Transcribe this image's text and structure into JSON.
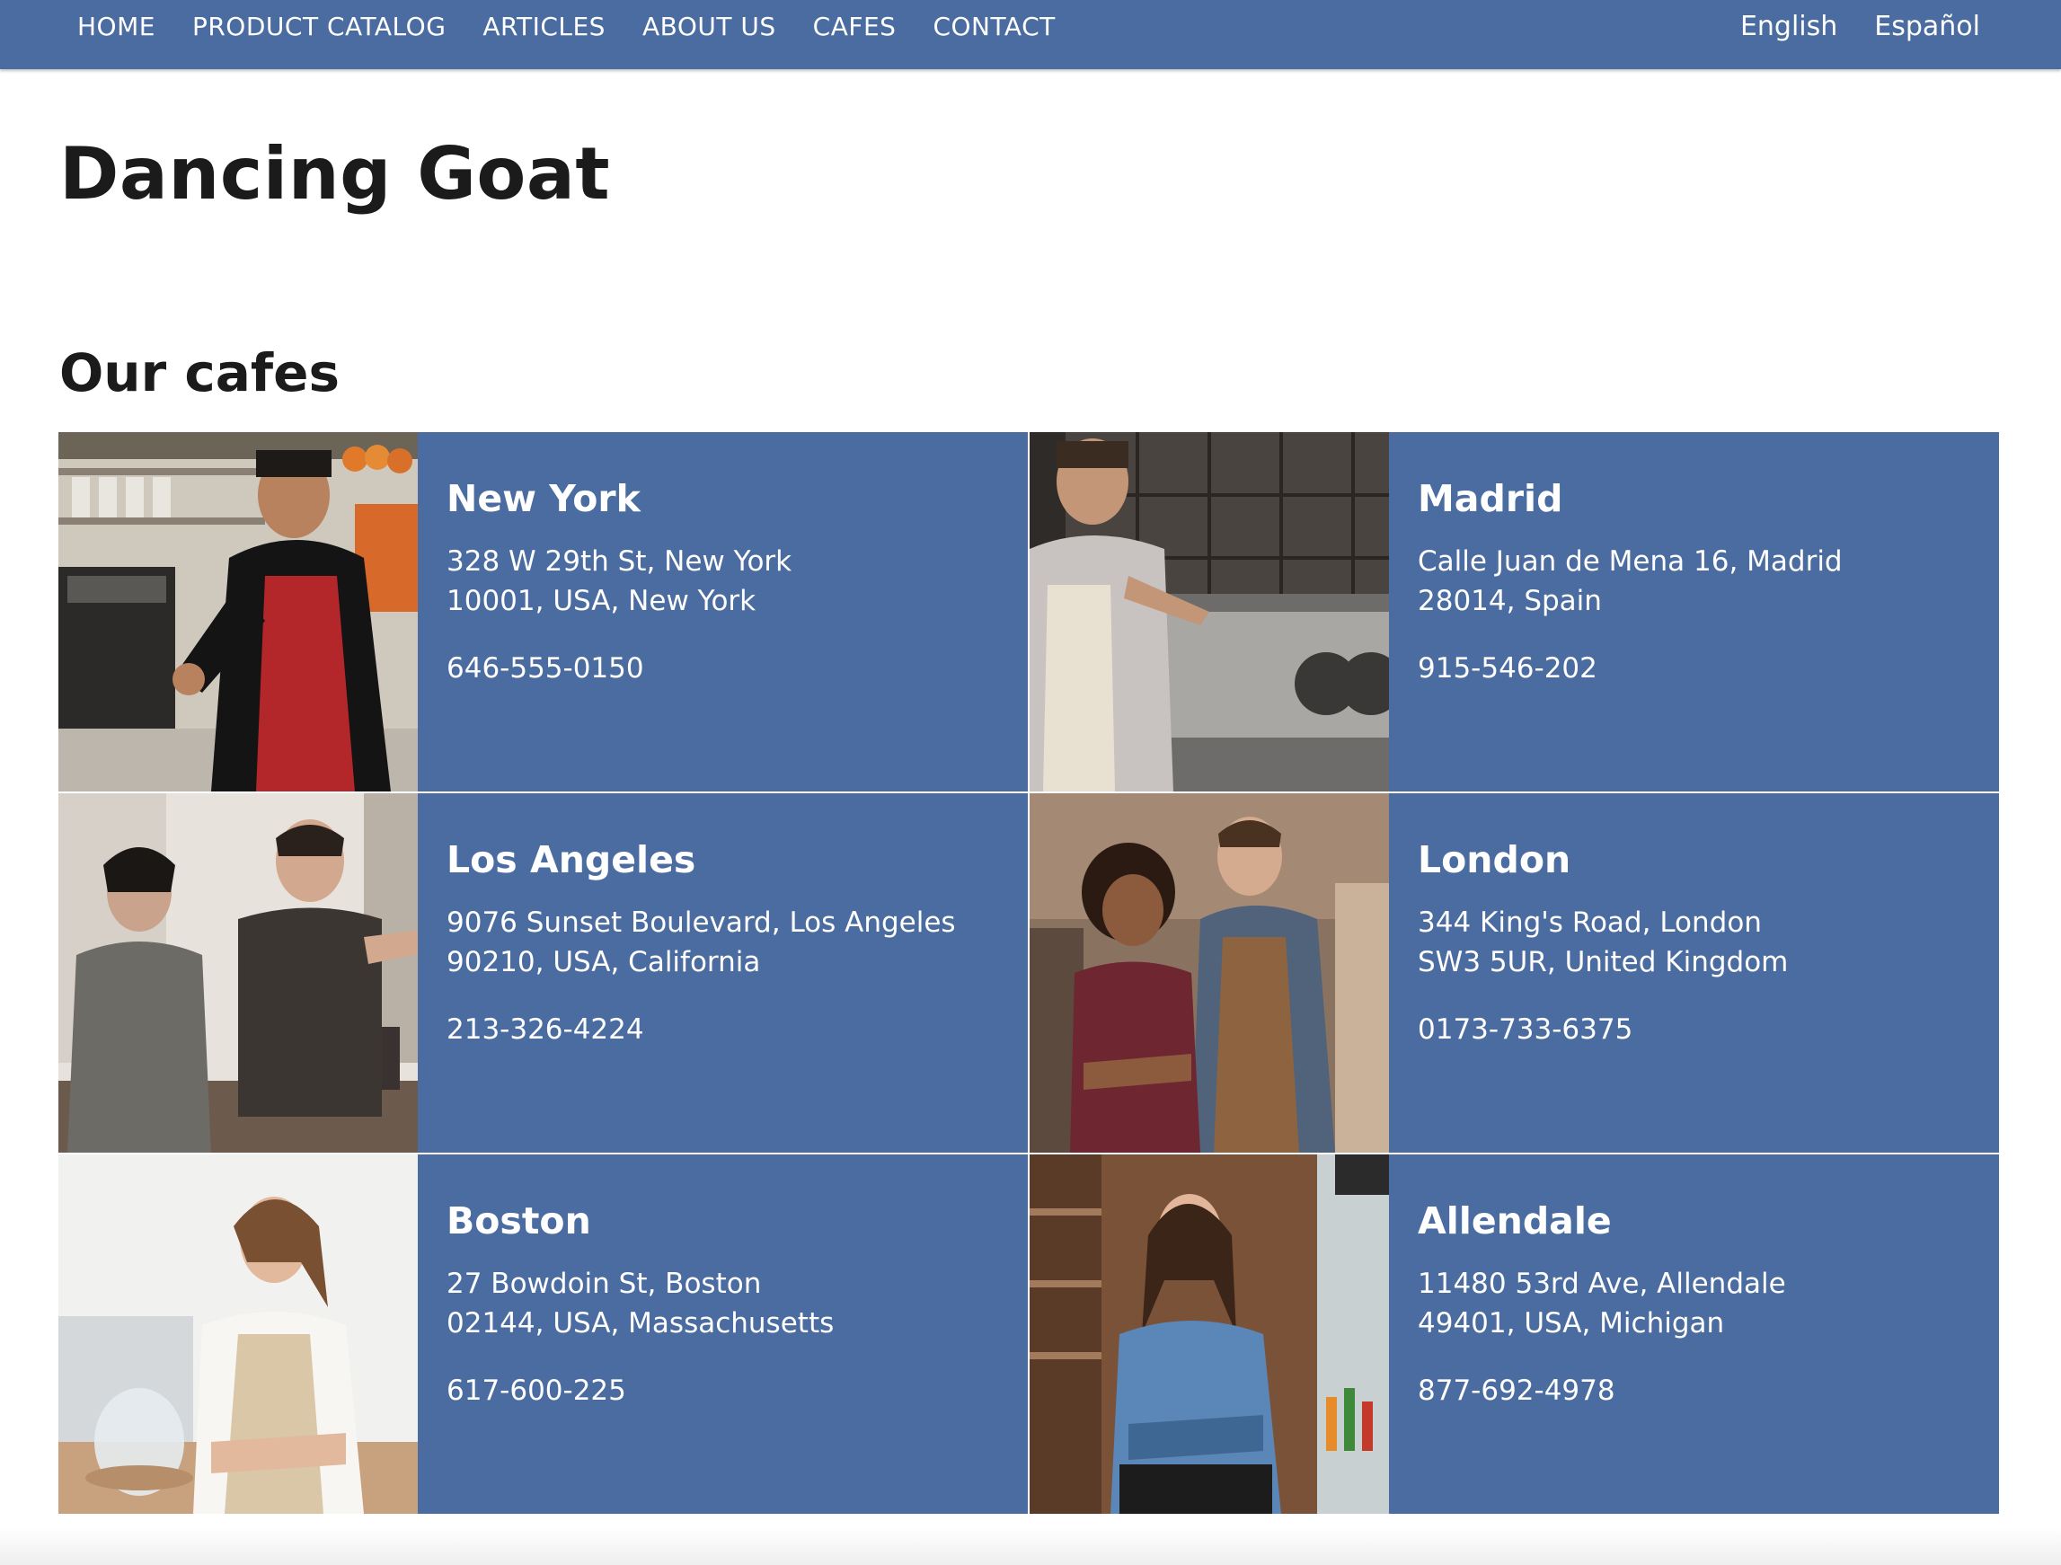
{
  "nav": {
    "items": [
      {
        "label": "HOME"
      },
      {
        "label": "PRODUCT CATALOG"
      },
      {
        "label": "ARTICLES"
      },
      {
        "label": "ABOUT US"
      },
      {
        "label": "CAFES"
      },
      {
        "label": "CONTACT"
      }
    ],
    "languages": [
      {
        "label": "English"
      },
      {
        "label": "Español"
      }
    ]
  },
  "site_title": "Dancing Goat",
  "section_title": "Our cafes",
  "cafes": [
    {
      "name": "New York",
      "address_line1": "328 W 29th St, New York",
      "address_line2": "10001, USA, New York",
      "phone": "646-555-0150"
    },
    {
      "name": "Madrid",
      "address_line1": "Calle Juan de Mena 16, Madrid",
      "address_line2": "28014, Spain",
      "phone": "915-546-202"
    },
    {
      "name": "Los Angeles",
      "address_line1": "9076 Sunset Boulevard, Los Angeles",
      "address_line2": "90210, USA, California",
      "phone": "213-326-4224"
    },
    {
      "name": "London",
      "address_line1": "344 King's Road, London",
      "address_line2": "SW3 5UR, United Kingdom",
      "phone": "0173-733-6375"
    },
    {
      "name": "Boston",
      "address_line1": "27 Bowdoin St, Boston",
      "address_line2": "02144, USA, Massachusetts",
      "phone": "617-600-225"
    },
    {
      "name": "Allendale",
      "address_line1": "11480 53rd Ave, Allendale",
      "address_line2": "49401, USA, Michigan",
      "phone": "877-692-4978"
    }
  ],
  "colors": {
    "nav_background": "#4a6ca0",
    "card_background": "#4a6ca0",
    "heading_text": "#1b1b1b"
  }
}
